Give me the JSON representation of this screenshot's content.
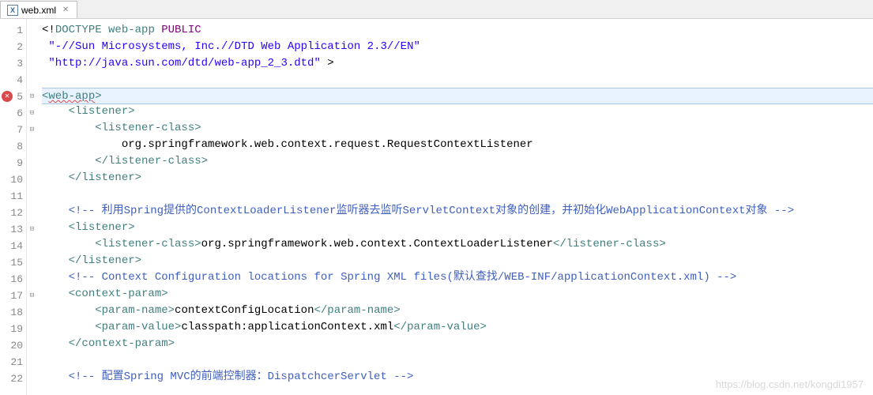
{
  "tab": {
    "icon_text": "X",
    "label": "web.xml",
    "close": "✕"
  },
  "fold_marks": {
    "5": "⊡",
    "6": "⊟",
    "7": "⊟",
    "13": "⊟",
    "17": "⊟"
  },
  "lines": [
    {
      "n": 1,
      "segs": [
        {
          "c": "t-black",
          "t": "<!"
        },
        {
          "c": "t-tag",
          "t": "DOCTYPE"
        },
        {
          "c": "t-black",
          "t": " "
        },
        {
          "c": "t-tag",
          "t": "web-app"
        },
        {
          "c": "t-black",
          "t": " "
        },
        {
          "c": "t-kw",
          "t": "PUBLIC"
        }
      ]
    },
    {
      "n": 2,
      "segs": [
        {
          "c": "t-black",
          "t": " "
        },
        {
          "c": "t-str",
          "t": "\"-//Sun Microsystems, Inc.//DTD Web Application 2.3//EN\""
        }
      ]
    },
    {
      "n": 3,
      "segs": [
        {
          "c": "t-black",
          "t": " "
        },
        {
          "c": "t-str",
          "t": "\"http://java.sun.com/dtd/web-app_2_3.dtd\""
        },
        {
          "c": "t-black",
          "t": " >"
        }
      ]
    },
    {
      "n": 4,
      "segs": [
        {
          "c": "t-black",
          "t": ""
        }
      ]
    },
    {
      "n": 5,
      "highlight": true,
      "error": true,
      "segs": [
        {
          "c": "t-tag",
          "t": "<"
        },
        {
          "c": "t-tag squiggle",
          "t": "web-app"
        },
        {
          "c": "t-tag",
          "t": ">"
        }
      ]
    },
    {
      "n": 6,
      "segs": [
        {
          "c": "t-black",
          "t": "    "
        },
        {
          "c": "t-tag",
          "t": "<listener>"
        }
      ]
    },
    {
      "n": 7,
      "segs": [
        {
          "c": "t-black",
          "t": "        "
        },
        {
          "c": "t-tag",
          "t": "<listener-class>"
        }
      ]
    },
    {
      "n": 8,
      "segs": [
        {
          "c": "t-black",
          "t": "            org.springframework.web.context.request.RequestContextListener"
        }
      ]
    },
    {
      "n": 9,
      "segs": [
        {
          "c": "t-black",
          "t": "        "
        },
        {
          "c": "t-tag",
          "t": "</listener-class>"
        }
      ]
    },
    {
      "n": 10,
      "segs": [
        {
          "c": "t-black",
          "t": "    "
        },
        {
          "c": "t-tag",
          "t": "</listener>"
        }
      ]
    },
    {
      "n": 11,
      "segs": [
        {
          "c": "t-black",
          "t": ""
        }
      ]
    },
    {
      "n": 12,
      "segs": [
        {
          "c": "t-black",
          "t": "    "
        },
        {
          "c": "t-comment",
          "t": "<!-- 利用Spring提供的ContextLoaderListener监听器去监听ServletContext对象的创建，并初始化WebApplicationContext对象 -->"
        }
      ]
    },
    {
      "n": 13,
      "segs": [
        {
          "c": "t-black",
          "t": "    "
        },
        {
          "c": "t-tag",
          "t": "<listener>"
        }
      ]
    },
    {
      "n": 14,
      "segs": [
        {
          "c": "t-black",
          "t": "        "
        },
        {
          "c": "t-tag",
          "t": "<listener-class>"
        },
        {
          "c": "t-black",
          "t": "org.springframework.web.context.ContextLoaderListener"
        },
        {
          "c": "t-tag",
          "t": "</listener-class>"
        }
      ]
    },
    {
      "n": 15,
      "segs": [
        {
          "c": "t-black",
          "t": "    "
        },
        {
          "c": "t-tag",
          "t": "</listener>"
        }
      ]
    },
    {
      "n": 16,
      "segs": [
        {
          "c": "t-black",
          "t": "    "
        },
        {
          "c": "t-comment",
          "t": "<!-- Context Configuration locations for Spring XML files(默认查找/WEB-INF/applicationContext.xml) -->"
        }
      ]
    },
    {
      "n": 17,
      "segs": [
        {
          "c": "t-black",
          "t": "    "
        },
        {
          "c": "t-tag",
          "t": "<context-param>"
        }
      ]
    },
    {
      "n": 18,
      "segs": [
        {
          "c": "t-black",
          "t": "        "
        },
        {
          "c": "t-tag",
          "t": "<param-name>"
        },
        {
          "c": "t-black",
          "t": "contextConfigLocation"
        },
        {
          "c": "t-tag",
          "t": "</param-name>"
        }
      ]
    },
    {
      "n": 19,
      "segs": [
        {
          "c": "t-black",
          "t": "        "
        },
        {
          "c": "t-tag",
          "t": "<param-value>"
        },
        {
          "c": "t-black",
          "t": "classpath:applicationContext.xml"
        },
        {
          "c": "t-tag",
          "t": "</param-value>"
        }
      ]
    },
    {
      "n": 20,
      "segs": [
        {
          "c": "t-black",
          "t": "    "
        },
        {
          "c": "t-tag",
          "t": "</context-param>"
        }
      ]
    },
    {
      "n": 21,
      "segs": [
        {
          "c": "t-black",
          "t": ""
        }
      ]
    },
    {
      "n": 22,
      "segs": [
        {
          "c": "t-black",
          "t": "    "
        },
        {
          "c": "t-comment",
          "t": "<!-- 配置Spring MVC的前端控制器：DispatchcerServlet -->"
        }
      ]
    }
  ],
  "watermark": "https://blog.csdn.net/kongdi1957"
}
